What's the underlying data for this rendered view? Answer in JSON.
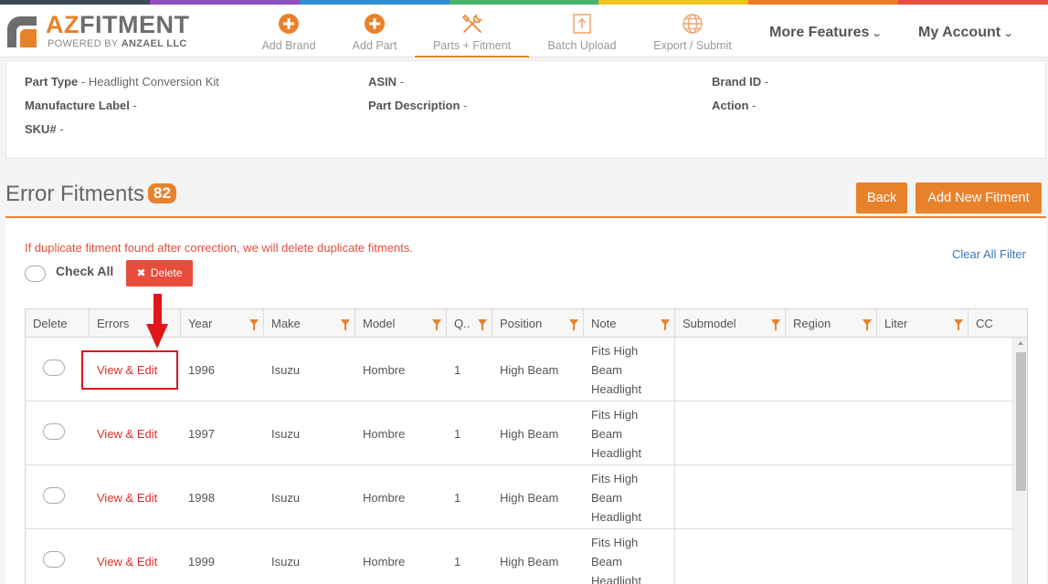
{
  "colors": {
    "accent": "#e8822a",
    "danger": "#e84c3d",
    "link": "#3a7ab8",
    "stripe": [
      "#3c4a55",
      "#8f4fbf",
      "#2f8dd6",
      "#47b36b",
      "#f0c419",
      "#ee7d22",
      "#e84c3d"
    ]
  },
  "brand": {
    "name_a": "AZ",
    "name_b": "FITMENT",
    "tagline_pre": "POWERED BY ",
    "tagline_strong": "ANZAEL LLC"
  },
  "nav": {
    "items": [
      {
        "label": "Add Brand",
        "icon": "plus-circle-icon"
      },
      {
        "label": "Add Part",
        "icon": "plus-circle-icon"
      },
      {
        "label": "Parts + Fitment",
        "icon": "tools-icon"
      },
      {
        "label": "Batch Upload",
        "icon": "upload-icon"
      },
      {
        "label": "Export / Submit",
        "icon": "globe-icon"
      }
    ],
    "more_features": "More Features",
    "my_account": "My Account"
  },
  "part_info": {
    "part_type_label": "Part Type",
    "part_type_value": "- Headlight Conversion Kit",
    "asin_label": "ASIN",
    "asin_value": "-",
    "brand_id_label": "Brand ID",
    "brand_id_value": "-",
    "manufacture_label": "Manufacture Label",
    "manufacture_value": "-",
    "part_description_label": "Part Description",
    "part_description_value": "-",
    "action_label": "Action",
    "action_value": "-",
    "sku_label": "SKU#",
    "sku_value": "-"
  },
  "section": {
    "title": "Error Fitments",
    "count": "82",
    "back_label": "Back",
    "add_new_label": "Add New Fitment"
  },
  "warning": "If duplicate fitment found after correction, we will delete duplicate fitments.",
  "clear_filter": "Clear All Filter",
  "check_all": "Check All",
  "delete_label": "Delete",
  "delete_icon_glyph": "✖",
  "table": {
    "columns": [
      "Delete",
      "Errors",
      "Year",
      "Make",
      "Model",
      "Q..",
      "Position",
      "Note",
      "Submodel",
      "Region",
      "Liter",
      "CC"
    ],
    "rows": [
      {
        "errors": "View & Edit",
        "year": "1996",
        "make": "Isuzu",
        "model": "Hombre",
        "qty": "1",
        "position": "High Beam",
        "note": [
          "Fits High",
          "Beam",
          "Headlight"
        ]
      },
      {
        "errors": "View & Edit",
        "year": "1997",
        "make": "Isuzu",
        "model": "Hombre",
        "qty": "1",
        "position": "High Beam",
        "note": [
          "Fits High",
          "Beam",
          "Headlight"
        ]
      },
      {
        "errors": "View & Edit",
        "year": "1998",
        "make": "Isuzu",
        "model": "Hombre",
        "qty": "1",
        "position": "High Beam",
        "note": [
          "Fits High",
          "Beam",
          "Headlight"
        ]
      },
      {
        "errors": "View & Edit",
        "year": "1999",
        "make": "Isuzu",
        "model": "Hombre",
        "qty": "1",
        "position": "High Beam",
        "note": [
          "Fits High",
          "Beam",
          "Headlight"
        ]
      }
    ]
  }
}
